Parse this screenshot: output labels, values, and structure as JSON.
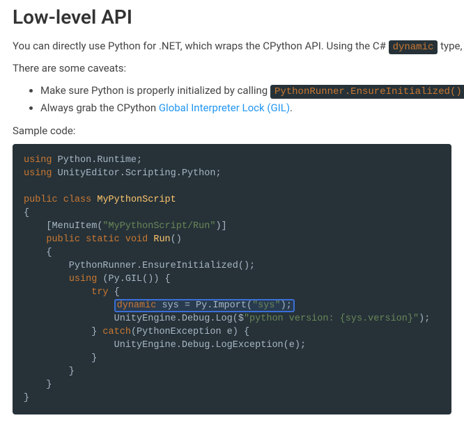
{
  "heading": "Low-level API",
  "intro_prefix": "You can directly use Python for .NET, which wraps the CPython API. Using the C# ",
  "intro_code": "dynamic",
  "intro_suffix": " type, you can",
  "caveats_intro": "There are some caveats:",
  "caveat1_prefix": "Make sure Python is properly initialized by calling ",
  "caveat1_code": "PythonRunner.EnsureInitialized()",
  "caveat1_suffix": ".",
  "caveat2_prefix": "Always grab the CPython ",
  "gil_link": "Global Interpreter Lock (GIL)",
  "caveat2_suffix": ".",
  "sample_label": "Sample code:",
  "code": {
    "kw_using": "using",
    "ns_python_runtime": " Python.Runtime;",
    "ns_unityeditor": " UnityEditor.Scripting.Python;",
    "kw_public": "public",
    "kw_class": "class",
    "cls_name": "MyPythonScript",
    "brace_open": "{",
    "menu_open": "    [MenuItem(",
    "menu_str": "\"MyPythonScript/Run\"",
    "menu_close": ")]",
    "kw_static": "static",
    "kw_void": "void",
    "fn_run": "Run",
    "run_parens": "()",
    "brace_open2": "    {",
    "ensure_call": "        PythonRunner.EnsureInitialized();",
    "gil_open": " (Py.GIL()) {",
    "kw_try": "try",
    "try_brace": " {",
    "kw_dynamic": "dynamic",
    "sys_assign_a": " sys = Py.Import(",
    "sys_str": "\"sys\"",
    "sys_assign_b": ");",
    "log_a": "                UnityEngine.Debug.Log($",
    "log_str": "\"python version: {sys.version}\"",
    "log_b": ");",
    "catch_close_brace": "            } ",
    "kw_catch": "catch",
    "catch_sig": "(PythonException e) {",
    "logexc": "                UnityEngine.Debug.LogException(e);",
    "close1": "            }",
    "close2": "        }",
    "close3": "    }",
    "close4": "}"
  }
}
